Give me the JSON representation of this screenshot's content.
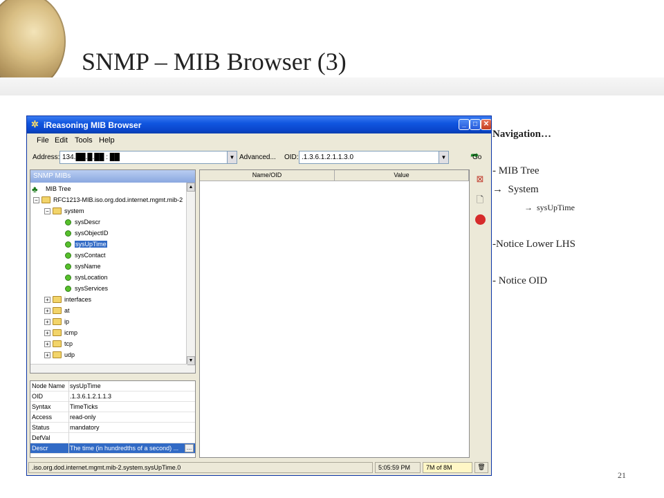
{
  "slide": {
    "title": "SNMP – MIB Browser (3)",
    "page_number": "21",
    "notes": [
      "Navigation…",
      "- MIB Tree",
      "System",
      "sysUpTime",
      "-Notice Lower LHS",
      "- Notice OID"
    ],
    "arrow_glyph": "→"
  },
  "window": {
    "title": "iReasoning MIB Browser",
    "menu": [
      "File",
      "Edit",
      "Tools",
      "Help"
    ],
    "address_label": "Address:",
    "address_value": "134.██.█.██ : ██",
    "advanced_label": "Advanced...",
    "oid_label": "OID:",
    "oid_value": ".1.3.6.1.2.1.1.3.0",
    "go_label": "Go",
    "tree_header": "SNMP MIBs",
    "tree": {
      "root": "MIB Tree",
      "rfc": "RFC1213-MIB.iso.org.dod.internet.mgmt.mib-2",
      "system": "system",
      "system_children": [
        "sysDescr",
        "sysObjectID",
        "sysUpTime",
        "sysContact",
        "sysName",
        "sysLocation",
        "sysServices"
      ],
      "selected": "sysUpTime",
      "groups": [
        "interfaces",
        "at",
        "ip",
        "icmp",
        "tcp",
        "udp"
      ]
    },
    "properties": [
      {
        "key": "Node Name",
        "value": "sysUpTime"
      },
      {
        "key": "OID",
        "value": ".1.3.6.1.2.1.1.3"
      },
      {
        "key": "Syntax",
        "value": "TimeTicks"
      },
      {
        "key": "Access",
        "value": "read-only"
      },
      {
        "key": "Status",
        "value": "mandatory"
      },
      {
        "key": "DefVal",
        "value": ""
      },
      {
        "key": "Descr",
        "value": "The time (in hundredths of a second) ..."
      }
    ],
    "columns": {
      "name_oid": "Name/OID",
      "value": "Value"
    },
    "status": {
      "path": ".iso.org.dod.internet.mgmt.mib-2.system.sysUpTime.0",
      "time": "5:05:59 PM",
      "memory": "7M of 8M"
    }
  }
}
